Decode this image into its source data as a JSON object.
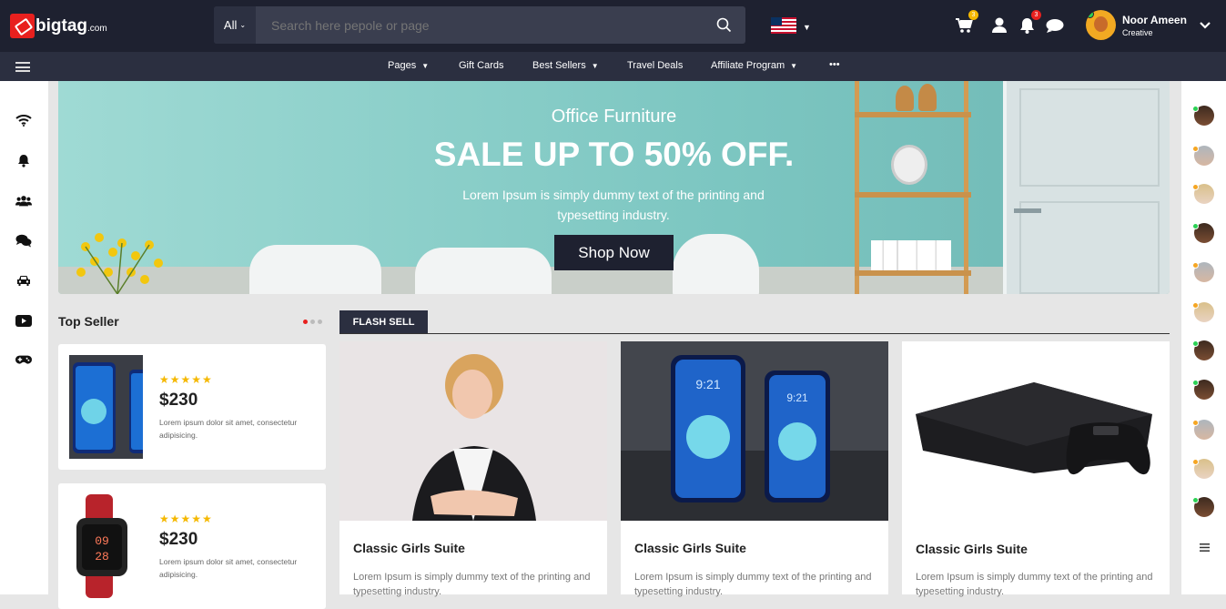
{
  "brand": {
    "name": "bigtag",
    "suffix": ".com"
  },
  "search": {
    "scope": "All",
    "placeholder": "Search here pepole or page"
  },
  "header": {
    "cart_badge": "3",
    "notification_badge": "3",
    "user": {
      "name": "Noor Ameen",
      "role": "Creative"
    }
  },
  "nav": {
    "items": [
      {
        "label": "Pages",
        "dropdown": true
      },
      {
        "label": "Gift Cards",
        "dropdown": false
      },
      {
        "label": "Best Sellers",
        "dropdown": true
      },
      {
        "label": "Travel Deals",
        "dropdown": false
      },
      {
        "label": "Affiliate Program",
        "dropdown": true
      }
    ],
    "more": "•••"
  },
  "left_sidebar": {
    "icons": [
      "wifi-icon",
      "bell-icon",
      "users-icon",
      "chat-icon",
      "car-icon",
      "video-icon",
      "gamepad-icon"
    ]
  },
  "right_sidebar": {
    "contacts": [
      "online",
      "away",
      "away",
      "online",
      "away",
      "away",
      "online",
      "online",
      "away",
      "away",
      "online"
    ]
  },
  "hero": {
    "subtitle": "Office Furniture",
    "title": "SALE UP TO 50% OFF.",
    "description": "Lorem Ipsum is simply dummy text of the printing and typesetting industry.",
    "button": "Shop Now"
  },
  "top_seller": {
    "title": "Top Seller",
    "items": [
      {
        "stars": "★★★★★",
        "price": "$230",
        "desc": "Lorem ipsum dolor sit amet, consectetur adipisicing."
      },
      {
        "stars": "★★★★★",
        "price": "$230",
        "desc": "Lorem ipsum dolor sit amet, consectetur adipisicing."
      }
    ]
  },
  "flash_sell": {
    "tab": "FLASH SELL",
    "products": [
      {
        "title": "Classic Girls Suite",
        "desc": "Lorem Ipsum is simply dummy text of the printing and typesetting industry."
      },
      {
        "title": "Classic Girls Suite",
        "desc": "Lorem Ipsum is simply dummy text of the printing and typesetting industry."
      },
      {
        "title": "Classic Girls Suite",
        "desc": "Lorem Ipsum is simply dummy text of the printing and typesetting industry."
      }
    ]
  },
  "colors": {
    "dark": "#1e2130",
    "nav": "#2b2f40",
    "accent": "#e8201e",
    "star": "#f5b800",
    "online": "#2bd154",
    "away": "#f5a623"
  }
}
